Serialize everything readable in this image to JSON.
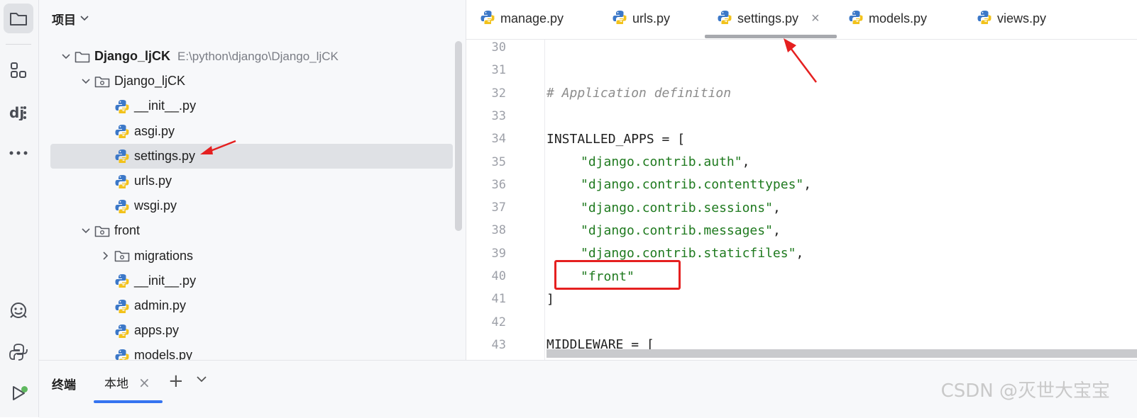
{
  "sidebar": {
    "icons": [
      "folder-icon",
      "structure-icon",
      "django-icon",
      "more-icon",
      "ai-assistant-icon",
      "python-console-icon",
      "run-icon"
    ]
  },
  "project": {
    "title": "项目",
    "tree": [
      {
        "label": "Django_ljCK",
        "path": "E:\\python\\django\\Django_ljCK",
        "type": "root-folder",
        "expanded": true
      },
      {
        "label": "Django_ljCK",
        "type": "package",
        "expanded": true
      },
      {
        "label": "__init__.py",
        "type": "python-file"
      },
      {
        "label": "asgi.py",
        "type": "python-file"
      },
      {
        "label": "settings.py",
        "type": "python-file",
        "selected": true
      },
      {
        "label": "urls.py",
        "type": "python-file"
      },
      {
        "label": "wsgi.py",
        "type": "python-file"
      },
      {
        "label": "front",
        "type": "package",
        "expanded": true
      },
      {
        "label": "migrations",
        "type": "package",
        "expanded": false
      },
      {
        "label": "__init__.py",
        "type": "python-file"
      },
      {
        "label": "admin.py",
        "type": "python-file"
      },
      {
        "label": "apps.py",
        "type": "python-file"
      },
      {
        "label": "models.py",
        "type": "python-file"
      }
    ]
  },
  "tabs": [
    {
      "label": "manage.py"
    },
    {
      "label": "urls.py"
    },
    {
      "label": "settings.py",
      "active": true,
      "close": "×"
    },
    {
      "label": "models.py"
    },
    {
      "label": "views.py"
    }
  ],
  "editor": {
    "lines": [
      {
        "n": "30",
        "code": "",
        "kind": "plain"
      },
      {
        "n": "31",
        "code": "",
        "kind": "plain"
      },
      {
        "n": "32",
        "code": "# Application definition",
        "kind": "comment"
      },
      {
        "n": "33",
        "code": "",
        "kind": "plain"
      },
      {
        "n": "34",
        "code": "INSTALLED_APPS = [",
        "kind": "plain"
      },
      {
        "n": "35",
        "code": "\"django.contrib.auth\"",
        "suffix": ",",
        "kind": "string"
      },
      {
        "n": "36",
        "code": "\"django.contrib.contenttypes\"",
        "suffix": ",",
        "kind": "string"
      },
      {
        "n": "37",
        "code": "\"django.contrib.sessions\"",
        "suffix": ",",
        "kind": "string"
      },
      {
        "n": "38",
        "code": "\"django.contrib.messages\"",
        "suffix": ",",
        "kind": "string"
      },
      {
        "n": "39",
        "code": "\"django.contrib.staticfiles\"",
        "suffix": ",",
        "kind": "string"
      },
      {
        "n": "40",
        "code": "\"front\"",
        "suffix": "",
        "kind": "string"
      },
      {
        "n": "41",
        "code": "]",
        "kind": "plain"
      },
      {
        "n": "42",
        "code": "",
        "kind": "plain"
      },
      {
        "n": "43",
        "code": "MIDDLEWARE = [",
        "kind": "plain"
      }
    ]
  },
  "terminal": {
    "title": "终端",
    "tab_label": "本地",
    "tab_close": "×",
    "add": "+"
  },
  "watermark": "CSDN @灭世大宝宝",
  "colors": {
    "accent": "#3574f0",
    "annotation_red": "#e52020",
    "string_green": "#1f7a1f",
    "comment_gray": "#8c8c8c"
  }
}
